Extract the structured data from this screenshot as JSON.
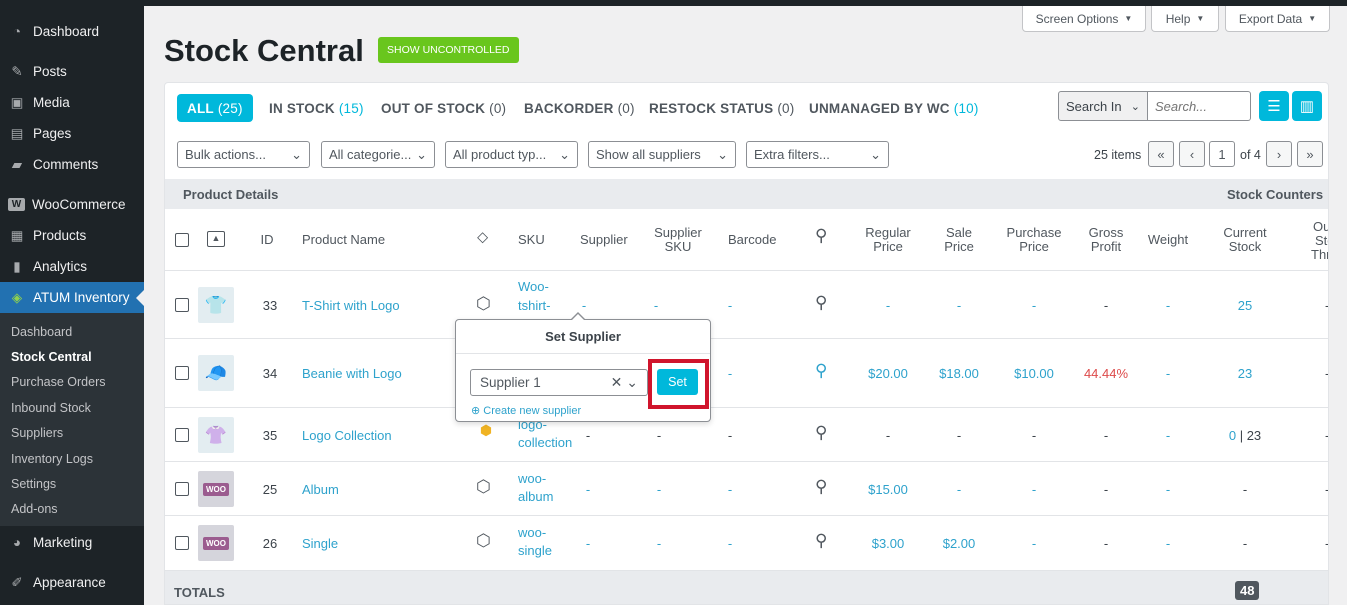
{
  "sidebar": {
    "menu": [
      {
        "label": "Dashboard",
        "icon": "dashboard-icon",
        "glyph": "◔"
      },
      {
        "label": "Posts",
        "icon": "pin-icon",
        "glyph": "✎"
      },
      {
        "label": "Media",
        "icon": "media-icon",
        "glyph": "▣"
      },
      {
        "label": "Pages",
        "icon": "pages-icon",
        "glyph": "▤"
      },
      {
        "label": "Comments",
        "icon": "comments-icon",
        "glyph": "▰"
      },
      {
        "label": "WooCommerce",
        "icon": "woocommerce-icon",
        "glyph": "W"
      },
      {
        "label": "Products",
        "icon": "products-icon",
        "glyph": "▦"
      },
      {
        "label": "Analytics",
        "icon": "analytics-icon",
        "glyph": "▮"
      },
      {
        "label": "ATUM Inventory",
        "icon": "atum-icon",
        "glyph": "◈"
      }
    ],
    "submenu": [
      "Dashboard",
      "Stock Central",
      "Purchase Orders",
      "Inbound Stock",
      "Suppliers",
      "Inventory Logs",
      "Settings",
      "Add-ons"
    ],
    "bottom": [
      {
        "label": "Marketing",
        "icon": "marketing-icon",
        "glyph": "◕"
      },
      {
        "label": "Appearance",
        "icon": "appearance-icon",
        "glyph": "✐"
      }
    ]
  },
  "top_buttons": {
    "screen_options": "Screen Options",
    "help": "Help",
    "export": "Export Data"
  },
  "page": {
    "title": "Stock Central",
    "uncontrolled": "SHOW UNCONTROLLED"
  },
  "tabs": [
    {
      "label": "ALL",
      "count": "(25)"
    },
    {
      "label": "IN STOCK",
      "count": "(15)"
    },
    {
      "label": "OUT OF STOCK",
      "count": "(0)"
    },
    {
      "label": "BACKORDER",
      "count": "(0)"
    },
    {
      "label": "RESTOCK STATUS",
      "count": "(0)"
    },
    {
      "label": "UNMANAGED BY WC",
      "count": "(10)"
    }
  ],
  "search": {
    "in_label": "Search In",
    "placeholder": "Search..."
  },
  "filters": [
    "Bulk actions...",
    "All categorie...",
    "All product typ...",
    "Show all suppliers",
    "Extra filters..."
  ],
  "pagination": {
    "items": "25 items",
    "first": "«",
    "prev": "‹",
    "current": "1",
    "of": "of 4",
    "next": "›",
    "last": "»"
  },
  "groups": {
    "left": "Product Details",
    "right": "Stock Counters"
  },
  "columns": {
    "id": "ID",
    "name": "Product Name",
    "sku": "SKU",
    "supplier": "Supplier",
    "supplier_sku_1": "Supplier",
    "supplier_sku_2": "SKU",
    "barcode": "Barcode",
    "regular_1": "Regular",
    "regular_2": "Price",
    "sale_1": "Sale",
    "sale_2": "Price",
    "purchase_1": "Purchase",
    "purchase_2": "Price",
    "gross_1": "Gross",
    "gross_2": "Profit",
    "weight": "Weight",
    "current_1": "Current",
    "current_2": "Stock",
    "out_1": "Out",
    "out_2": "Stock",
    "out_3": "Thres"
  },
  "rows": [
    {
      "id": "33",
      "name": "T-Shirt with Logo",
      "thumb": "👕",
      "sku": [
        "Woo-",
        "tshirt-",
        ""
      ],
      "supplier": "-",
      "supplier_sku": "-",
      "barcode": "-",
      "regular": "-",
      "sale": "-",
      "purchase": "-",
      "gross": "-",
      "weight": "-",
      "stock": "25",
      "out": "-"
    },
    {
      "id": "34",
      "name": "Beanie with Logo",
      "thumb": "🧢",
      "sku": [
        "",
        ""
      ],
      "supplier": "",
      "supplier_sku": "",
      "barcode": "-",
      "regular": "$20.00",
      "sale": "$18.00",
      "purchase": "$10.00",
      "gross": "44.44%",
      "weight": "-",
      "stock": "23",
      "out": "-"
    },
    {
      "id": "35",
      "name": "Logo Collection",
      "thumb": "👚",
      "sku": [
        "logo-",
        "collection"
      ],
      "supplier": "-",
      "supplier_sku": "-",
      "barcode": "-",
      "regular": "-",
      "sale": "-",
      "purchase": "-",
      "gross": "-",
      "weight": "-",
      "stock_a": "0",
      "stock_sep": " | ",
      "stock_b": "23",
      "out": "-"
    },
    {
      "id": "25",
      "name": "Album",
      "thumb": "WOO",
      "sku": [
        "woo-",
        "album"
      ],
      "supplier": "-",
      "supplier_sku": "-",
      "barcode": "-",
      "regular": "$15.00",
      "sale": "-",
      "purchase": "-",
      "gross": "-",
      "weight": "-",
      "stock": "-",
      "out": "-"
    },
    {
      "id": "26",
      "name": "Single",
      "thumb": "WOO",
      "sku": [
        "woo-",
        "single"
      ],
      "supplier": "-",
      "supplier_sku": "-",
      "barcode": "-",
      "regular": "$3.00",
      "sale": "$2.00",
      "purchase": "-",
      "gross": "-",
      "weight": "-",
      "stock": "-",
      "out": "-"
    }
  ],
  "totals": {
    "label": "TOTALS",
    "stock": "48"
  },
  "popup": {
    "title": "Set Supplier",
    "selected": "Supplier 1",
    "set": "Set",
    "create": "Create new supplier"
  },
  "colors": {
    "accent": "#00b8db",
    "link": "#2ea2cc",
    "green": "#69c61d",
    "highlight": "#d0142c",
    "profit": "#dd4a4a"
  }
}
